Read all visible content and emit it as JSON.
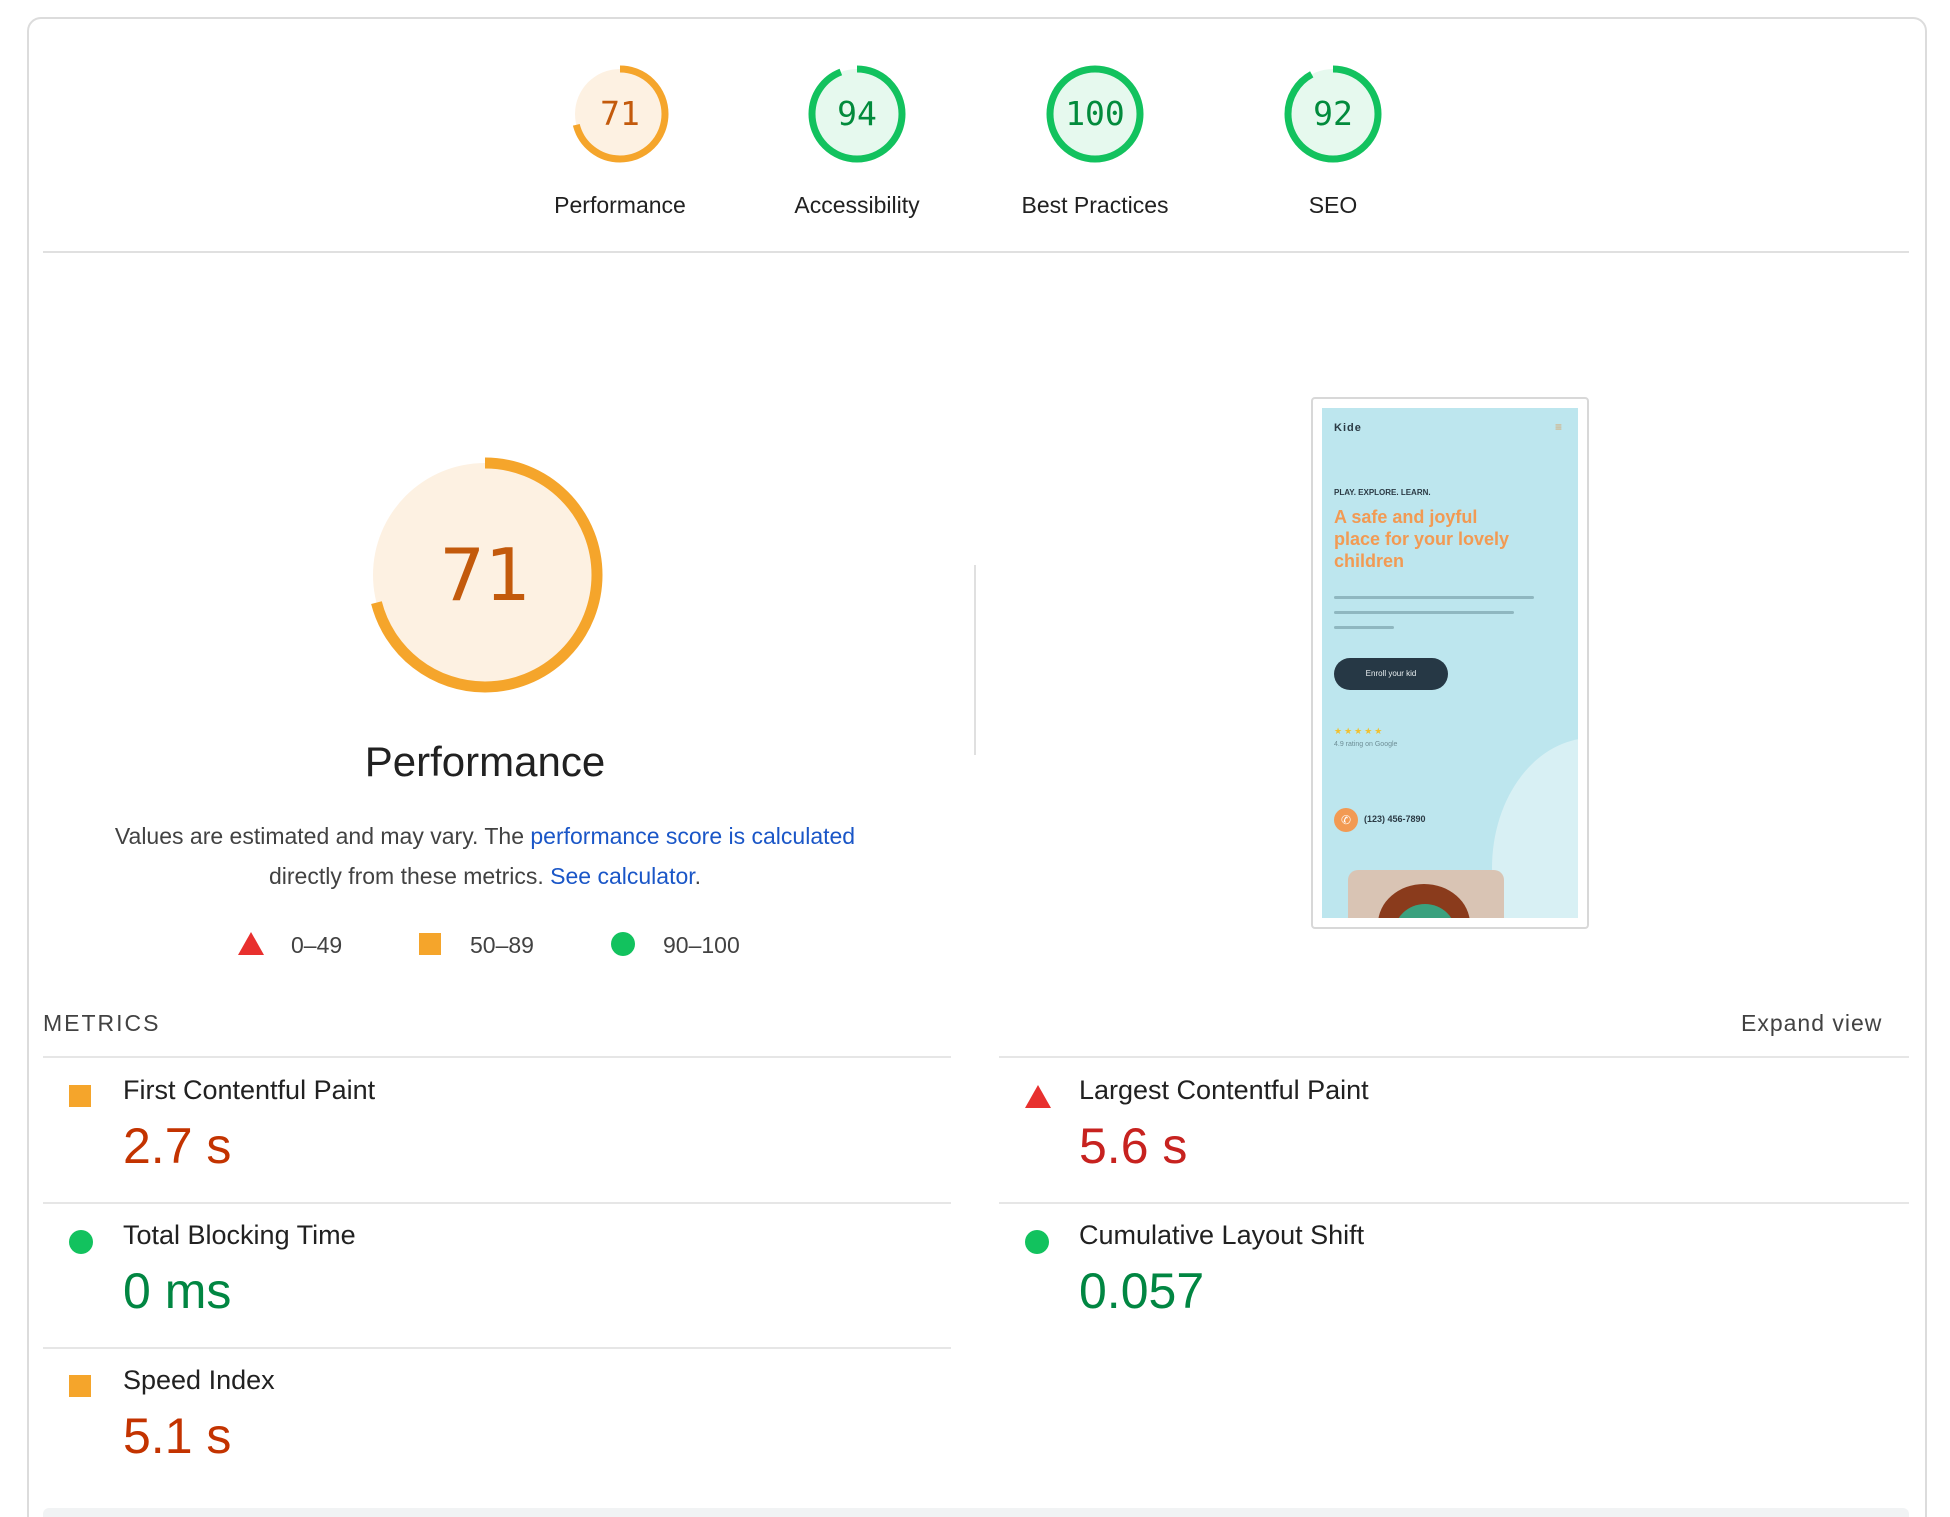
{
  "gauges": [
    {
      "score": "71",
      "label": "Performance",
      "fraction": 0.71,
      "color": "#f5a52b",
      "bg": "#fdf1e2",
      "text_color": "#c35a0c"
    },
    {
      "score": "94",
      "label": "Accessibility",
      "fraction": 0.94,
      "color": "#12c25e",
      "bg": "#e6f9ee",
      "text_color": "#028b3c"
    },
    {
      "score": "100",
      "label": "Best Practices",
      "fraction": 1.0,
      "color": "#12c25e",
      "bg": "#e6f9ee",
      "text_color": "#028b3c"
    },
    {
      "score": "92",
      "label": "SEO",
      "fraction": 0.92,
      "color": "#12c25e",
      "bg": "#e6f9ee",
      "text_color": "#028b3c"
    }
  ],
  "performance": {
    "score": "71",
    "fraction": 0.71,
    "title": "Performance",
    "desc_part1": "Values are estimated and may vary. The ",
    "desc_link1": "performance score is calculated",
    "desc_part2": "directly from these metrics. ",
    "desc_link2": "See calculator",
    "desc_end": "."
  },
  "legend": [
    {
      "icon": "triangle-icon",
      "range": "0–49",
      "color": "#e8302e"
    },
    {
      "icon": "square-icon",
      "range": "50–89",
      "color": "#f5a52b"
    },
    {
      "icon": "circle-icon",
      "range": "90–100",
      "color": "#12c25e"
    }
  ],
  "screenshot": {
    "brand": "Kide",
    "eyebrow": "PLAY. EXPLORE. LEARN.",
    "headline": "A safe and joyful place for your lovely children",
    "button": "Enroll your kid",
    "stars": "★★★★★",
    "rating": "4.9 rating on Google",
    "phone": "(123) 456-7890"
  },
  "metrics_section": {
    "header": "METRICS",
    "expand": "Expand view",
    "items": [
      {
        "label": "First Contentful Paint",
        "value": "2.7 s",
        "status": "average",
        "icon": "square-icon"
      },
      {
        "label": "Largest Contentful Paint",
        "value": "5.6 s",
        "status": "fail",
        "icon": "triangle-icon"
      },
      {
        "label": "Total Blocking Time",
        "value": "0 ms",
        "status": "pass",
        "icon": "circle-icon"
      },
      {
        "label": "Cumulative Layout Shift",
        "value": "0.057",
        "status": "pass",
        "icon": "circle-icon"
      },
      {
        "label": "Speed Index",
        "value": "5.1 s",
        "status": "average",
        "icon": "square-icon"
      }
    ]
  }
}
